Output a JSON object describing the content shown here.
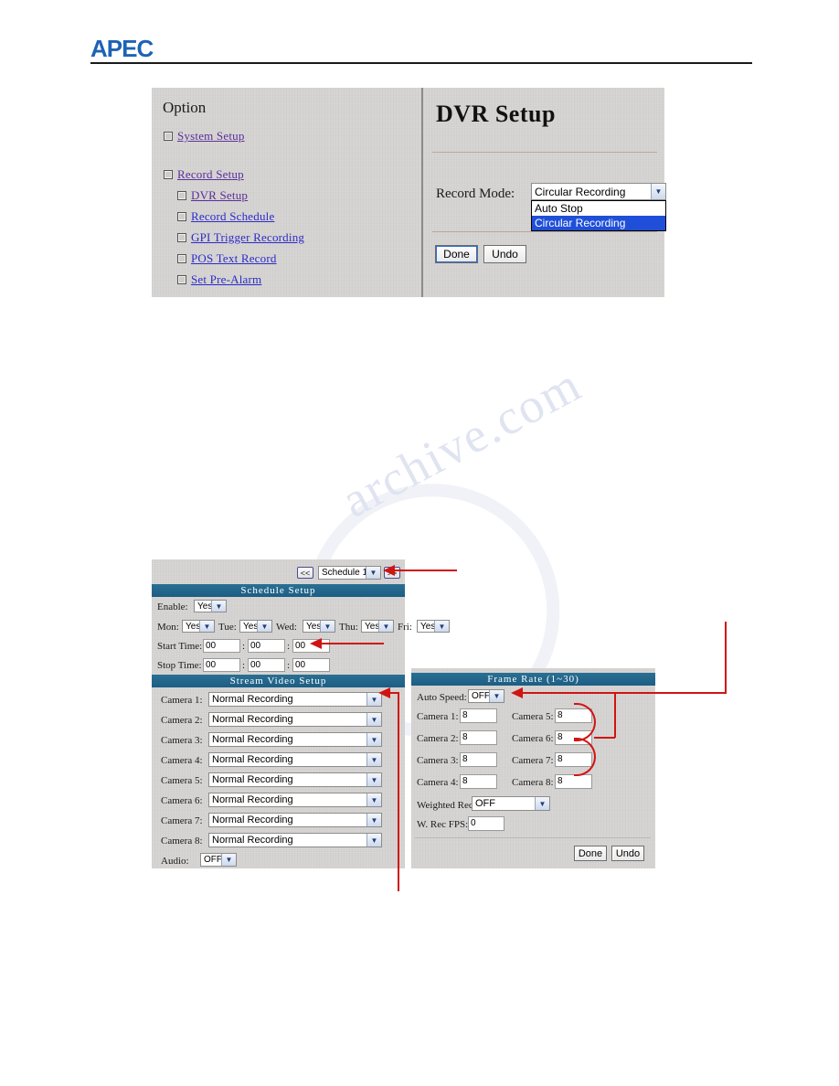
{
  "page": {
    "brand": "APEC",
    "watermark_text": "archive.com"
  },
  "figure1": {
    "option_panel": {
      "title": "Option",
      "items": [
        {
          "label": "System Setup",
          "indent": false,
          "color": "purple"
        },
        {
          "label": "Record Setup",
          "indent": false,
          "color": "purple"
        },
        {
          "label": "DVR Setup",
          "indent": true,
          "color": "purple"
        },
        {
          "label": "Record Schedule",
          "indent": true,
          "color": "blue"
        },
        {
          "label": "GPI Trigger Recording",
          "indent": true,
          "color": "blue"
        },
        {
          "label": "POS Text Record",
          "indent": true,
          "color": "blue"
        },
        {
          "label": "Set Pre-Alarm",
          "indent": true,
          "color": "blue"
        }
      ]
    },
    "dvr_panel": {
      "title": "DVR Setup",
      "record_mode_label": "Record Mode:",
      "record_mode_value": "Circular Recording",
      "record_mode_options": [
        "Auto Stop",
        "Circular Recording"
      ],
      "record_mode_selected_option": "Circular Recording",
      "done_label": "Done",
      "undo_label": "Undo"
    }
  },
  "figure2": {
    "nav": {
      "prev_label": "<<",
      "next_label": ">>",
      "schedule_value": "Schedule 1"
    },
    "schedule_setup": {
      "bar_title": "Schedule Setup",
      "enable_label": "Enable:",
      "enable_value": "Yes",
      "days": [
        {
          "label": "Mon:",
          "value": "Yes"
        },
        {
          "label": "Tue:",
          "value": "Yes"
        },
        {
          "label": "Wed:",
          "value": "Yes"
        },
        {
          "label": "Thu:",
          "value": "Yes"
        },
        {
          "label": "Fri:",
          "value": "Yes"
        }
      ],
      "start_time_label": "Start Time:",
      "start_time": [
        "00",
        "00",
        "00"
      ],
      "stop_time_label": "Stop Time:",
      "stop_time": [
        "00",
        "00",
        "00"
      ]
    },
    "stream_video_setup": {
      "bar_title": "Stream Video Setup",
      "cameras": [
        {
          "label": "Camera 1:",
          "value": "Normal Recording"
        },
        {
          "label": "Camera 2:",
          "value": "Normal Recording"
        },
        {
          "label": "Camera 3:",
          "value": "Normal Recording"
        },
        {
          "label": "Camera 4:",
          "value": "Normal Recording"
        },
        {
          "label": "Camera 5:",
          "value": "Normal Recording"
        },
        {
          "label": "Camera 6:",
          "value": "Normal Recording"
        },
        {
          "label": "Camera 7:",
          "value": "Normal Recording"
        },
        {
          "label": "Camera 8:",
          "value": "Normal Recording"
        }
      ],
      "audio_label": "Audio:",
      "audio_value": "OFF"
    }
  },
  "figure3": {
    "bar_title": "Frame Rate (1~30)",
    "auto_speed_label": "Auto Speed:",
    "auto_speed_value": "OFF",
    "cameras_left": [
      {
        "label": "Camera 1:",
        "value": "8"
      },
      {
        "label": "Camera 2:",
        "value": "8"
      },
      {
        "label": "Camera 3:",
        "value": "8"
      },
      {
        "label": "Camera 4:",
        "value": "8"
      }
    ],
    "cameras_right": [
      {
        "label": "Camera 5:",
        "value": "8"
      },
      {
        "label": "Camera 6:",
        "value": "8"
      },
      {
        "label": "Camera 7:",
        "value": "8"
      },
      {
        "label": "Camera 8:",
        "value": "8"
      }
    ],
    "weighted_rec_label": "Weighted Rec:",
    "weighted_rec_value": "OFF",
    "w_rec_fps_label": "W. Rec FPS:",
    "w_rec_fps_value": "0",
    "done_label": "Done",
    "undo_label": "Undo"
  },
  "colors": {
    "brand": "#1d63b5",
    "annotation": "#d01414",
    "bar": "#1d5d84",
    "link_purple": "#5a2f9b",
    "link_blue": "#2b2bc8",
    "highlight": "#1f4fd8"
  }
}
